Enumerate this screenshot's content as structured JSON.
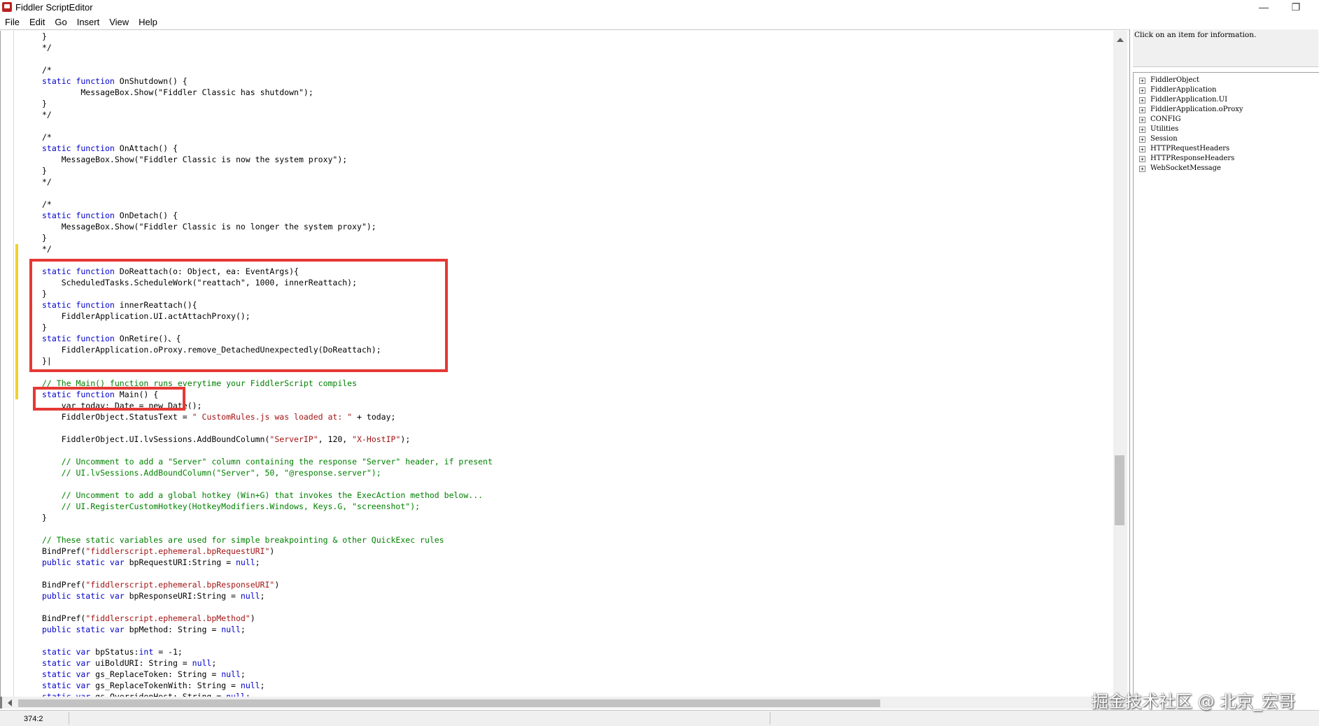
{
  "window": {
    "title": "Fiddler ScriptEditor",
    "minimize_glyph": "—",
    "restore_glyph": "❐"
  },
  "menu": [
    "File",
    "Edit",
    "Go",
    "Insert",
    "View",
    "Help"
  ],
  "code_lines": [
    [
      [
        "",
        "}"
      ]
    ],
    [
      [
        "",
        "*/"
      ]
    ],
    [
      [
        "",
        ""
      ]
    ],
    [
      [
        "",
        "/*"
      ]
    ],
    [
      [
        "kw",
        "static function"
      ],
      [
        "",
        " OnShutdown() {"
      ]
    ],
    [
      [
        "",
        "        MessageBox.Show("
      ],
      [
        "",
        "\"Fiddler Classic has shutdown\""
      ],
      [
        "",
        ");"
      ]
    ],
    [
      [
        "",
        "}"
      ]
    ],
    [
      [
        "",
        "*/"
      ]
    ],
    [
      [
        "",
        ""
      ]
    ],
    [
      [
        "",
        "/*"
      ]
    ],
    [
      [
        "kw",
        "static function"
      ],
      [
        "",
        " OnAttach() {"
      ]
    ],
    [
      [
        "",
        "    MessageBox.Show(\"Fiddler Classic is now the system proxy\");"
      ]
    ],
    [
      [
        "",
        "}"
      ]
    ],
    [
      [
        "",
        "*/"
      ]
    ],
    [
      [
        "",
        ""
      ]
    ],
    [
      [
        "",
        "/*"
      ]
    ],
    [
      [
        "kw",
        "static function"
      ],
      [
        "",
        " OnDetach() {"
      ]
    ],
    [
      [
        "",
        "    MessageBox.Show(\"Fiddler Classic is no longer the system proxy\");"
      ]
    ],
    [
      [
        "",
        "}"
      ]
    ],
    [
      [
        "",
        "*/"
      ]
    ],
    [
      [
        "",
        ""
      ]
    ],
    [
      [
        "kw",
        "static function"
      ],
      [
        "",
        " DoReattach(o: Object, ea: EventArgs){"
      ]
    ],
    [
      [
        "",
        "    ScheduledTasks.ScheduleWork(\"reattach\", 1000, innerReattach);"
      ]
    ],
    [
      [
        "",
        "}"
      ]
    ],
    [
      [
        "kw",
        "static function"
      ],
      [
        "",
        " innerReattach(){"
      ]
    ],
    [
      [
        "",
        "    FiddlerApplication.UI.actAttachProxy();"
      ]
    ],
    [
      [
        "",
        "}"
      ]
    ],
    [
      [
        "kw",
        "static function"
      ],
      [
        "",
        " OnRetire()、{"
      ]
    ],
    [
      [
        "",
        "    FiddlerApplication.oProxy.remove_DetachedUnexpectedly(DoReattach);"
      ]
    ],
    [
      [
        "",
        "}|"
      ]
    ],
    [
      [
        "",
        ""
      ]
    ],
    [
      [
        "cm",
        "// The Main() function runs everytime your FiddlerScript compiles"
      ]
    ],
    [
      [
        "kw",
        "static function"
      ],
      [
        "",
        " Main() {"
      ]
    ],
    [
      [
        "",
        "    var today: Date = new Date();"
      ]
    ],
    [
      [
        "",
        "    FiddlerObject.StatusText = "
      ],
      [
        "str",
        "\" CustomRules.js was loaded at: \""
      ],
      [
        "",
        " + today;"
      ]
    ],
    [
      [
        "",
        ""
      ]
    ],
    [
      [
        "",
        "    FiddlerObject.UI.lvSessions.AddBoundColumn("
      ],
      [
        "str",
        "\"ServerIP\""
      ],
      [
        "",
        ", 120, "
      ],
      [
        "str",
        "\"X-HostIP\""
      ],
      [
        "",
        ");"
      ]
    ],
    [
      [
        "",
        ""
      ]
    ],
    [
      [
        "cm",
        "    // Uncomment to add a \"Server\" column containing the response \"Server\" header, if present"
      ]
    ],
    [
      [
        "cm",
        "    // UI.lvSessions.AddBoundColumn(\"Server\", 50, \"@response.server\");"
      ]
    ],
    [
      [
        "",
        ""
      ]
    ],
    [
      [
        "cm",
        "    // Uncomment to add a global hotkey (Win+G) that invokes the ExecAction method below..."
      ]
    ],
    [
      [
        "cm",
        "    // UI.RegisterCustomHotkey(HotkeyModifiers.Windows, Keys.G, \"screenshot\");"
      ]
    ],
    [
      [
        "",
        "}"
      ]
    ],
    [
      [
        "",
        ""
      ]
    ],
    [
      [
        "cm",
        "// These static variables are used for simple breakpointing & other QuickExec rules"
      ]
    ],
    [
      [
        "",
        "BindPref("
      ],
      [
        "str",
        "\"fiddlerscript.ephemeral.bpRequestURI\""
      ],
      [
        "",
        ")"
      ]
    ],
    [
      [
        "kw",
        "public static var"
      ],
      [
        "",
        " bpRequestURI:String = "
      ],
      [
        "kw",
        "null"
      ],
      [
        "",
        ";"
      ]
    ],
    [
      [
        "",
        ""
      ]
    ],
    [
      [
        "",
        "BindPref("
      ],
      [
        "str",
        "\"fiddlerscript.ephemeral.bpResponseURI\""
      ],
      [
        "",
        ")"
      ]
    ],
    [
      [
        "kw",
        "public static var"
      ],
      [
        "",
        " bpResponseURI:String = "
      ],
      [
        "kw",
        "null"
      ],
      [
        "",
        ";"
      ]
    ],
    [
      [
        "",
        ""
      ]
    ],
    [
      [
        "",
        "BindPref("
      ],
      [
        "str",
        "\"fiddlerscript.ephemeral.bpMethod\""
      ],
      [
        "",
        ")"
      ]
    ],
    [
      [
        "kw",
        "public static var"
      ],
      [
        "",
        " bpMethod: String = "
      ],
      [
        "kw",
        "null"
      ],
      [
        "",
        ";"
      ]
    ],
    [
      [
        "",
        ""
      ]
    ],
    [
      [
        "kw",
        "static var"
      ],
      [
        "",
        " bpStatus:"
      ],
      [
        "kw",
        "int"
      ],
      [
        "",
        " = -1;"
      ]
    ],
    [
      [
        "kw",
        "static var"
      ],
      [
        "",
        " uiBoldURI: String = "
      ],
      [
        "kw",
        "null"
      ],
      [
        "",
        ";"
      ]
    ],
    [
      [
        "kw",
        "static var"
      ],
      [
        "",
        " gs_ReplaceToken: String = "
      ],
      [
        "kw",
        "null"
      ],
      [
        "",
        ";"
      ]
    ],
    [
      [
        "kw",
        "static var"
      ],
      [
        "",
        " gs_ReplaceTokenWith: String = "
      ],
      [
        "kw",
        "null"
      ],
      [
        "",
        ";"
      ]
    ],
    [
      [
        "kw",
        "static var"
      ],
      [
        "",
        " gs_OverridenHost: String = "
      ],
      [
        "kw",
        "null"
      ],
      [
        "",
        ";"
      ]
    ]
  ],
  "right_panel": {
    "info_text": "Click on an item for information.",
    "tree_items": [
      "FiddlerObject",
      "FiddlerApplication",
      "FiddlerApplication.UI",
      "FiddlerApplication.oProxy",
      "CONFIG",
      "Utilities",
      "Session",
      "HTTPRequestHeaders",
      "HTTPResponseHeaders",
      "WebSocketMessage"
    ],
    "expander_glyph": "+"
  },
  "status": {
    "position": "374:2"
  },
  "watermark": "掘金技术社区 @ 北京_宏哥",
  "colors": {
    "keyword": "#0000cc",
    "string": "#a31515",
    "comment": "#008000",
    "highlight_box": "#e53935",
    "change_bar": "#f0d030"
  }
}
